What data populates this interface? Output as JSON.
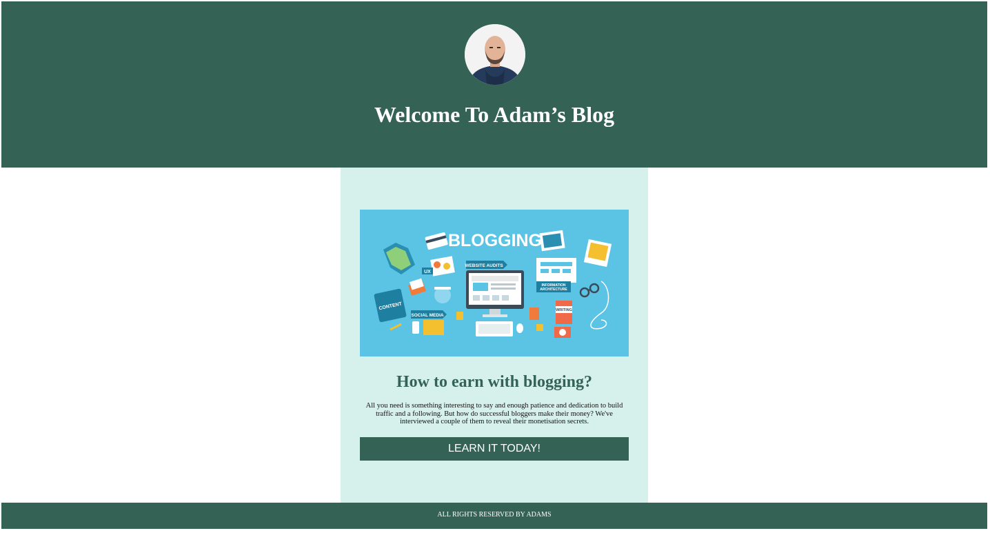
{
  "header": {
    "title": "Welcome To Adam’s Blog",
    "avatar_icon": "profile-photo-icon",
    "background": "#346356"
  },
  "post": {
    "image": {
      "banner_text": "BLOGGING",
      "labels": {
        "website_audits": "WEBSITE AUDITS",
        "ux": "UX",
        "information_architecture_line1": "INFORMATION",
        "information_architecture_line2": "ARCHITECTURE",
        "content": "CONTENT",
        "social_media": "SOCIAL MEDIA",
        "writing": "WRITING"
      },
      "background": "#5bc3e4"
    },
    "title": "How to earn with blogging?",
    "text": "All you need is something interesting to say and enough patience and dedication to build traffic and a following. But how do successful bloggers make their money? We've interviewed a couple of them to reveal their monetisation secrets.",
    "cta_label": "LEARN IT TODAY!",
    "card_background": "#d6f0eb"
  },
  "footer": {
    "text": "ALL RIGHTS RESERVED BY ADAMS"
  }
}
